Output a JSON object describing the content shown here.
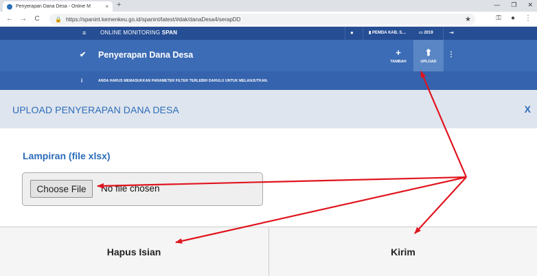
{
  "browser": {
    "tab_title": "Penyerapan Dana Desa - Online M",
    "tab_close": "×",
    "new_tab": "+",
    "win_min": "—",
    "win_max": "❐",
    "win_close": "✕",
    "back": "←",
    "forward": "→",
    "reload": "C",
    "lock": "🔒",
    "url": "https://spanint.kemenkeu.go.id/spanint/latest/#dak/danaDesa4/serapDD",
    "star": "★",
    "key": "⚿",
    "account": "●",
    "menu": "⋮"
  },
  "topbar": {
    "menu_icon": "≡",
    "app_name": "ONLINE MONITORING",
    "app_name_bold": "SPAN",
    "chat_icon": "●",
    "user": "▮ PEMDA KAB. S…",
    "year": "▭ 2019",
    "exit_icon": "⇥"
  },
  "subbar": {
    "check": "✔",
    "page_title": "Penyerapan Dana Desa",
    "add_icon": "+",
    "add_label": "TAMBAH",
    "upload_icon": "⬆",
    "upload_label": "UPLOAD",
    "more_icon": "⋮"
  },
  "infobar": {
    "icon": "i",
    "message": "ANDA HARUS MEMASUKKAN PARAMETER FILTER TERLEBIH DAHULU UNTUK MELANJUTKAN."
  },
  "modal": {
    "title": "UPLOAD PENYERAPAN DANA DESA",
    "close": "X",
    "field_label": "Lampiran (file xlsx)",
    "choose_file": "Choose File",
    "file_status": "No file chosen",
    "clear_button": "Hapus Isian",
    "submit_button": "Kirim"
  },
  "colors": {
    "annotation": "#e0141e",
    "header_dark": "#254e94",
    "header": "#3c6cb5",
    "accent": "#2b6cb8"
  }
}
